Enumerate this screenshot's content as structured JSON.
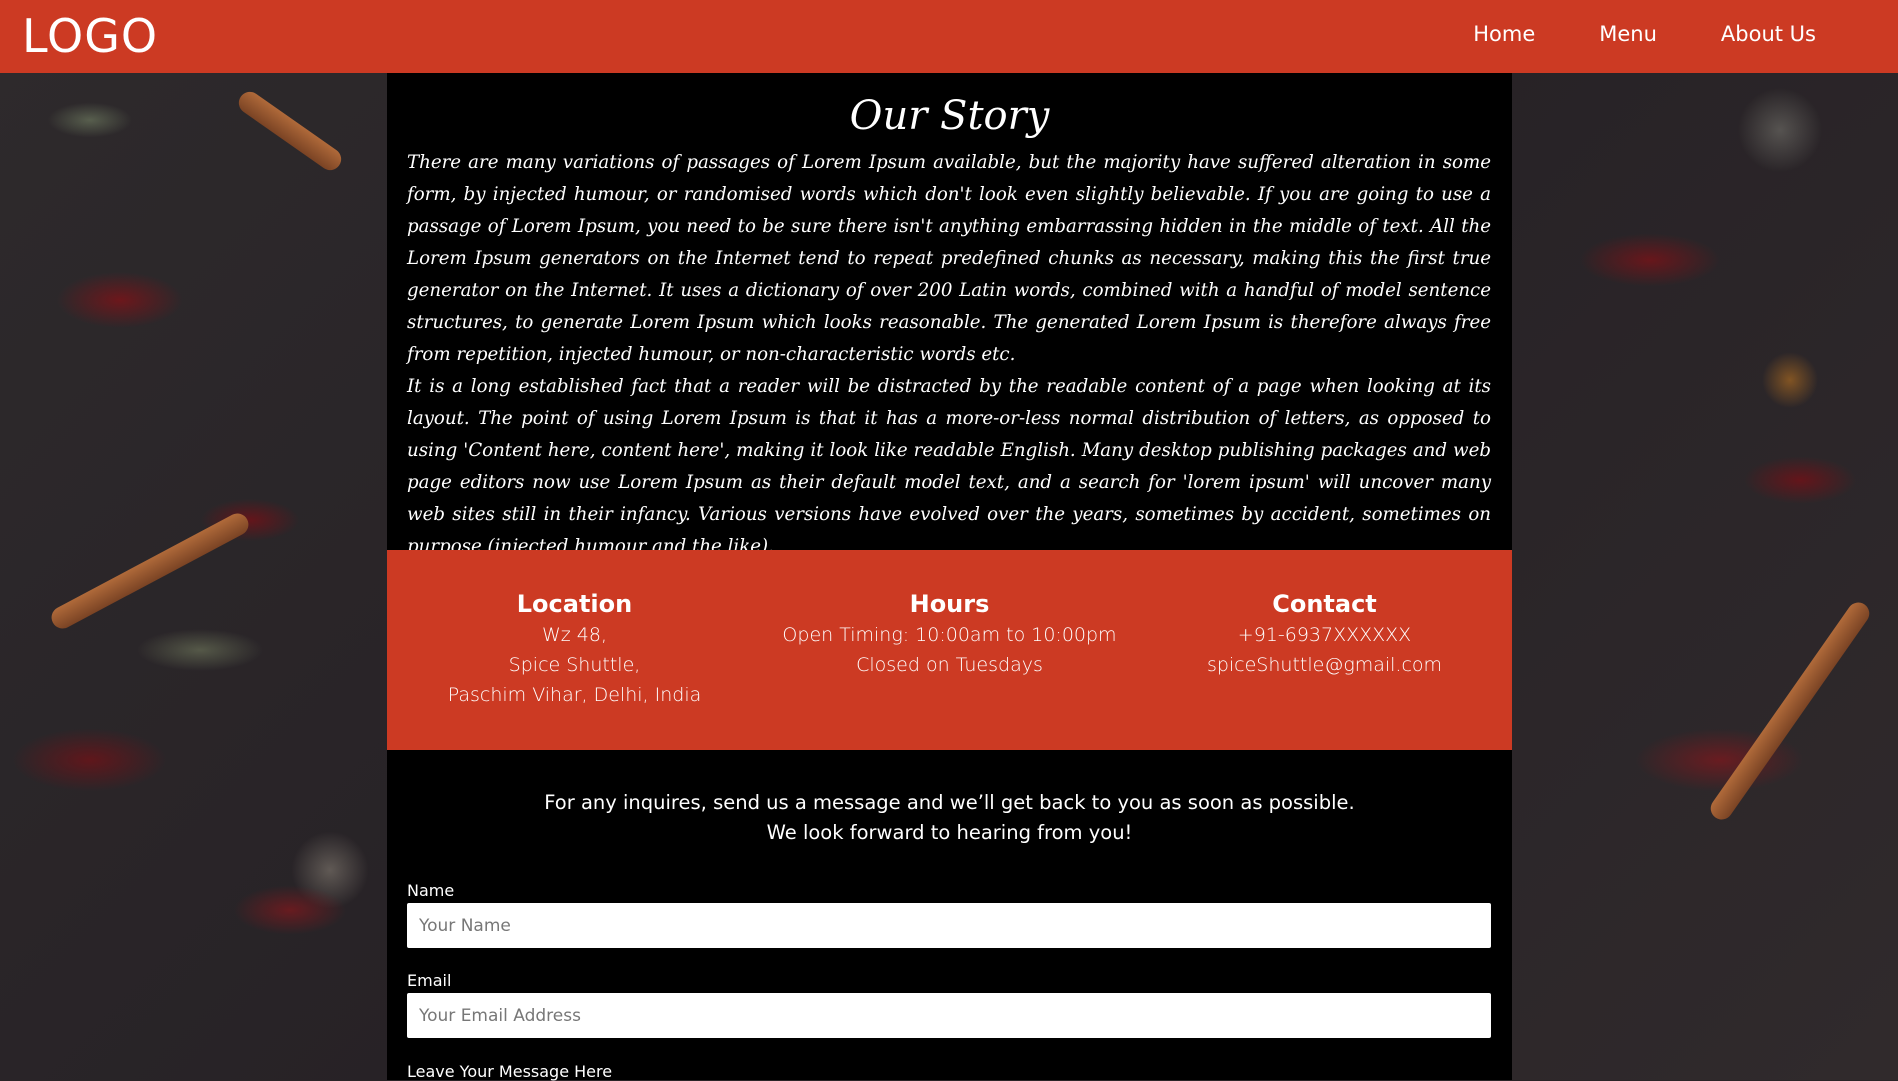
{
  "navbar": {
    "logo": "LOGO",
    "links": [
      "Home",
      "Menu",
      "About Us"
    ]
  },
  "story": {
    "title": "Our Story",
    "paragraphs": [
      "There are many variations of passages of Lorem Ipsum available, but the majority have suffered alteration in some form, by injected humour, or randomised words which don't look even slightly believable. If you are going to use a passage of Lorem Ipsum, you need to be sure there isn't anything embarrassing hidden in the middle of text. All the Lorem Ipsum generators on the Internet tend to repeat predefined chunks as necessary, making this the first true generator on the Internet. It uses a dictionary of over 200 Latin words, combined with a handful of model sentence structures, to generate Lorem Ipsum which looks reasonable. The generated Lorem Ipsum is therefore always free from repetition, injected humour, or non-characteristic words etc.",
      "It is a long established fact that a reader will be distracted by the readable content of a page when looking at its layout. The point of using Lorem Ipsum is that it has a more-or-less normal distribution of letters, as opposed to using 'Content here, content here', making it look like readable English. Many desktop publishing packages and web page editors now use Lorem Ipsum as their default model text, and a search for 'lorem ipsum' will uncover many web sites still in their infancy. Various versions have evolved over the years, sometimes by accident, sometimes on purpose (injected humour and the like)."
    ]
  },
  "info": {
    "location": {
      "heading": "Location",
      "lines": [
        "Wz 48,",
        "Spice Shuttle,",
        "Paschim Vihar, Delhi, India"
      ]
    },
    "hours": {
      "heading": "Hours",
      "lines": [
        "Open Timing: 10:00am to 10:00pm",
        "Closed on Tuesdays"
      ]
    },
    "contact": {
      "heading": "Contact",
      "lines": [
        "+91-6937XXXXXX",
        "spiceShuttle@gmail.com"
      ]
    }
  },
  "inquiry": {
    "line1": "For any inquires, send us a message and we’ll get back to you as soon as possible.",
    "line2": "We look forward to hearing from you!"
  },
  "form": {
    "name_label": "Name",
    "name_placeholder": "Your Name",
    "email_label": "Email",
    "email_placeholder": "Your Email Address",
    "message_label": "Leave Your Message Here"
  },
  "colors": {
    "accent": "#cc3a23",
    "content_bg": "#000000",
    "text": "#ffffff"
  }
}
